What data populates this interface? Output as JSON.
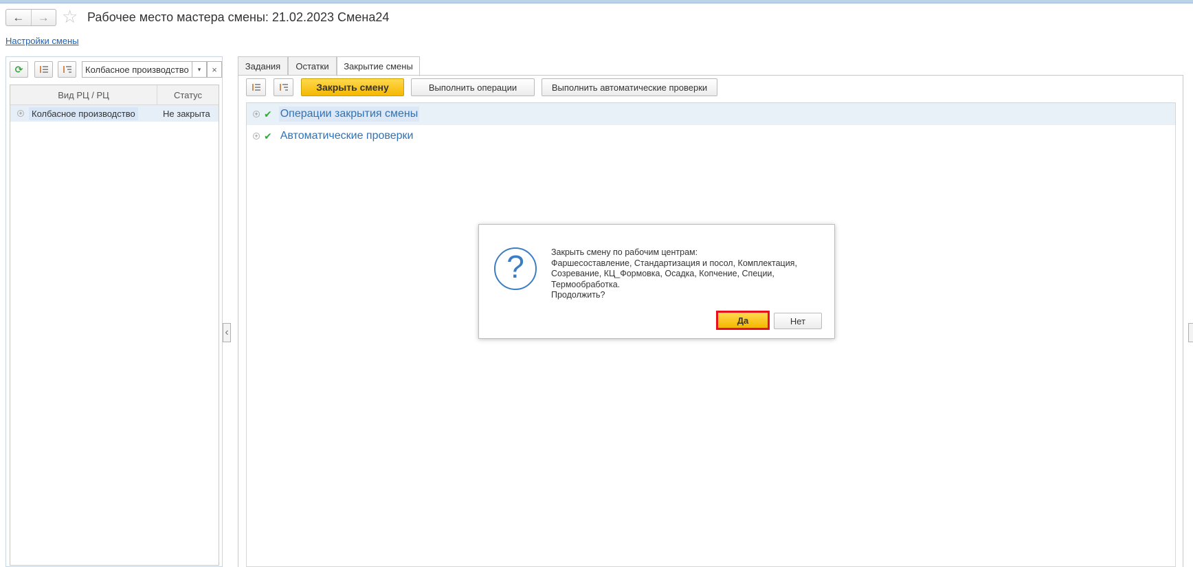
{
  "header": {
    "back_icon": "←",
    "forward_icon": "→",
    "favorite_icon": "☆",
    "title": "Рабочее место мастера смены: 21.02.2023 Смена24",
    "settings_link": "Настройки смены"
  },
  "left_panel": {
    "refresh_icon": "⟳",
    "filter_value": "Колбасное производство",
    "dropdown_icon": "▾",
    "clear_icon": "×",
    "columns": [
      "Вид РЦ / РЦ",
      "Статус"
    ],
    "rows": [
      {
        "name": "Колбасное производство",
        "status": "Не закрыта"
      }
    ]
  },
  "tabs": [
    {
      "label": "Задания",
      "active": false
    },
    {
      "label": "Остатки",
      "active": false
    },
    {
      "label": "Закрытие смены",
      "active": true
    }
  ],
  "toolbar": {
    "close_shift": "Закрыть смену",
    "run_operations": "Выполнить операции",
    "run_auto_checks": "Выполнить автоматические проверки"
  },
  "tree": [
    {
      "label": "Операции закрытия смены",
      "checked": true
    },
    {
      "label": "Автоматические проверки",
      "checked": true
    }
  ],
  "dialog": {
    "message_lines": [
      "Закрыть смену по рабочим центрам:",
      "Фаршесоставление, Стандартизация и посол, Комплектация,",
      "Созревание, КЦ_Формовка, Осадка, Копчение, Специи,",
      "Термообработка.",
      "Продолжить?"
    ],
    "yes": "Да",
    "no": "Нет"
  },
  "colors": {
    "accent_yellow": "#f5b700",
    "link_blue": "#1d5fb0",
    "highlight_red": "#e8101a",
    "check_green": "#3aa640"
  }
}
